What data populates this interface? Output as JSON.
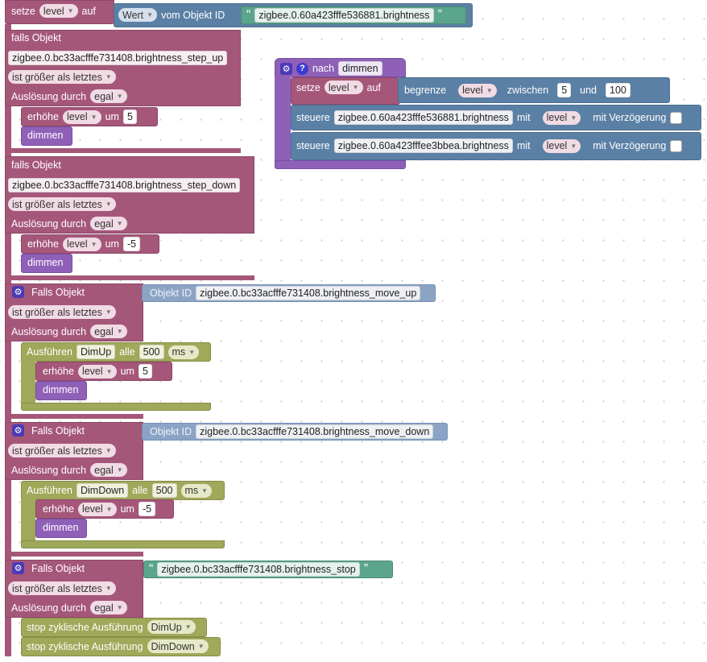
{
  "b1": {
    "setze": "setze",
    "var": "level",
    "auf": "auf",
    "value_type": "Wert",
    "vom": "vom Objekt ID",
    "obj": "zigbee.0.60a423fffe536881.brightness"
  },
  "b2": {
    "falls": "falls Objekt",
    "obj": "zigbee.0.bc33acfffe731408.brightness_step_up",
    "cond": "ist größer als letztes",
    "ausl": "Auslösung durch",
    "ausl_val": "egal",
    "inc": "erhöhe",
    "inc_var": "level",
    "um": "um",
    "inc_val": "5",
    "call": "dimmen"
  },
  "b3": {
    "falls": "falls Objekt",
    "obj": "zigbee.0.bc33acfffe731408.brightness_step_down",
    "cond": "ist größer als letztes",
    "ausl": "Auslösung durch",
    "ausl_val": "egal",
    "inc": "erhöhe",
    "inc_var": "level",
    "um": "um",
    "inc_val": "-5",
    "call": "dimmen"
  },
  "fn": {
    "nach": "nach",
    "name": "dimmen",
    "setze": "setze",
    "var": "level",
    "auf": "auf",
    "begrenze": "begrenze",
    "clamp_var": "level",
    "zwischen": "zwischen",
    "min": "5",
    "und": "und",
    "max": "100",
    "steuere": "steuere",
    "obj1": "zigbee.0.60a423fffe536881.brightness",
    "obj2": "zigbee.0.60a423fffee3bbea.brightness",
    "mit": "mit",
    "val": "level",
    "delay": "mit Verzögerung"
  },
  "b4": {
    "falls": "Falls Objekt",
    "objid": "Objekt ID",
    "obj": "zigbee.0.bc33acfffe731408.brightness_move_up",
    "cond": "ist größer als letztes",
    "ausl": "Auslösung durch",
    "ausl_val": "egal",
    "run": "Ausführen",
    "timer": "DimUp",
    "alle": "alle",
    "interval": "500",
    "unit": "ms",
    "inc": "erhöhe",
    "inc_var": "level",
    "um": "um",
    "inc_val": "5",
    "call": "dimmen"
  },
  "b5": {
    "falls": "Falls Objekt",
    "objid": "Objekt ID",
    "obj": "zigbee.0.bc33acfffe731408.brightness_move_down",
    "cond": "ist größer als letztes",
    "ausl": "Auslösung durch",
    "ausl_val": "egal",
    "run": "Ausführen",
    "timer": "DimDown",
    "alle": "alle",
    "interval": "500",
    "unit": "ms",
    "inc": "erhöhe",
    "inc_var": "level",
    "um": "um",
    "inc_val": "-5",
    "call": "dimmen"
  },
  "b6": {
    "falls": "Falls Objekt",
    "obj": "zigbee.0.bc33acfffe731408.brightness_stop",
    "cond": "ist größer als letztes",
    "ausl": "Auslösung durch",
    "ausl_val": "egal",
    "stop": "stop zyklische Ausführung",
    "t1": "DimUp",
    "t2": "DimDown"
  },
  "colors": {
    "event": "#a5577a",
    "timer": "#a0a85a",
    "action": "#5b80a5",
    "procedure": "#8f60b8",
    "text": "#5ba58c",
    "objid": "#8ba4c6"
  },
  "icons": {
    "settings": "gear-icon",
    "help": "help-icon",
    "dropdown": "chevron-down-icon",
    "quote": "quote-icon"
  }
}
